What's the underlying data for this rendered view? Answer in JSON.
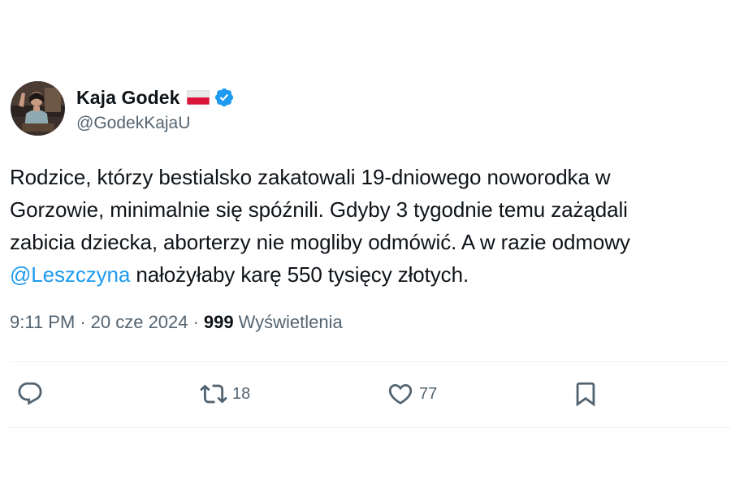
{
  "author": {
    "display_name": "Kaja Godek",
    "handle": "@GodekKajaU",
    "flag_icon": "poland-flag-icon",
    "verified_icon": "verified-badge-icon",
    "verified_color": "#1d9bf0"
  },
  "tweet": {
    "lines": [
      "Rodzice, którzy bestialsko zakatowali 19-dniowego noworodka w",
      "Gorzowie, minimalnie się spóźnili. Gdyby 3 tygodnie temu zażądali",
      "zabicia dziecka, aborterzy nie mogliby odmówić. A w razie odmowy"
    ],
    "mention": "@Leszczyna",
    "last_line_rest": " nałożyłaby karę 550 tysięcy złotych.",
    "time": "9:11 PM",
    "date": "20 cze 2024",
    "separator": "·",
    "views_count": "999",
    "views_label": "Wyświetlenia",
    "mention_color": "#1d9bf0"
  },
  "actions": {
    "reply": {
      "icon": "reply-icon",
      "count": ""
    },
    "retweet": {
      "icon": "retweet-icon",
      "count": "18"
    },
    "like": {
      "icon": "heart-icon",
      "count": "77"
    },
    "bookmark": {
      "icon": "bookmark-icon",
      "count": ""
    }
  }
}
